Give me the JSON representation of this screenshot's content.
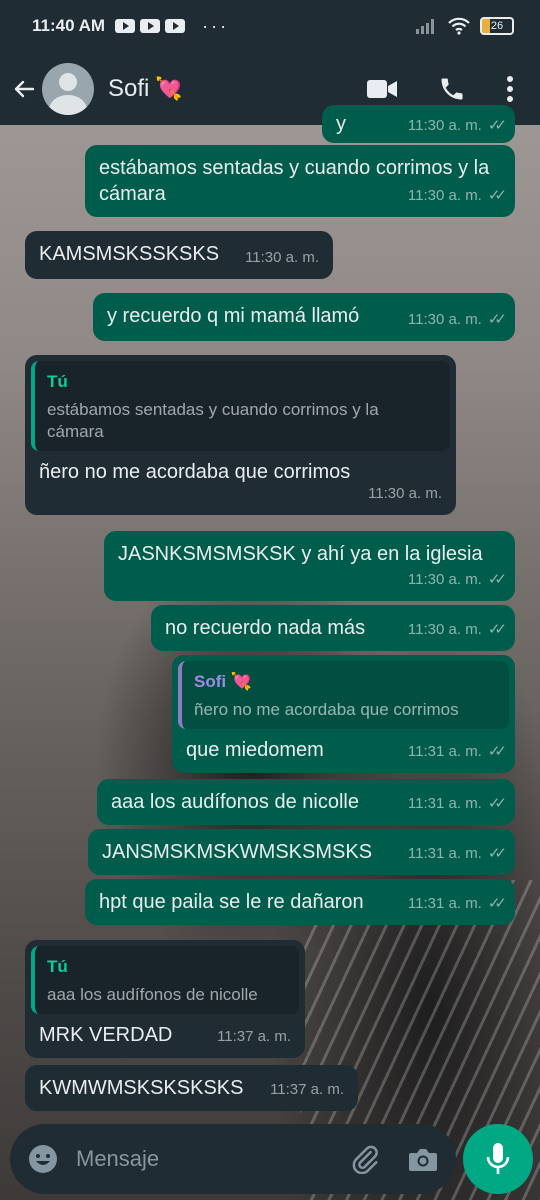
{
  "status_bar": {
    "time": "11:40 AM",
    "dots": "···",
    "battery": "26"
  },
  "header": {
    "contact_name": "Sofi",
    "emoji": "💘"
  },
  "messages": [
    {
      "text": "estábamos sentadas y cuando corrimos y la cámara",
      "time": "11:30 a. m."
    },
    {
      "text": "KAMSMSKSSKSKS",
      "time": "11:30 a. m."
    },
    {
      "text": "y recuerdo q mi mamá llamó",
      "time": "11:30 a. m."
    },
    {
      "quote_name": "Tú",
      "quote_text": "estábamos sentadas y cuando corrimos y la cámara",
      "text": "ñero no me acordaba que corrimos",
      "time": "11:30 a. m."
    },
    {
      "text": "JASNKSMSMSKSK y ahí ya en la iglesia",
      "time": "11:30 a. m."
    },
    {
      "text": "no recuerdo nada más",
      "time": "11:30 a. m."
    },
    {
      "quote_name": "Sofi 💘",
      "quote_text": "ñero no me acordaba que corrimos",
      "text": "que miedomem",
      "time": "11:31 a. m."
    },
    {
      "text": "aaa los audífonos de nicolle",
      "time": "11:31 a. m."
    },
    {
      "text": "JANSMSKMSKWMSKSMSKS",
      "time": "11:31 a. m."
    },
    {
      "text": "hpt que paila se le re dañaron",
      "time": "11:31 a. m."
    },
    {
      "quote_name": "Tú",
      "quote_text": "aaa los audífonos de nicolle",
      "text": "MRK VERDAD",
      "time": "11:37 a. m."
    },
    {
      "text": "KWMWMSKSKSKSKS",
      "time": "11:37 a. m."
    }
  ],
  "partial_top": {
    "text": "y",
    "time": "11:30 a. m."
  },
  "input": {
    "placeholder": "Mensaje"
  },
  "colors": {
    "outgoing": "#005c4b",
    "incoming": "#1f2c34",
    "accent": "#00a884"
  }
}
